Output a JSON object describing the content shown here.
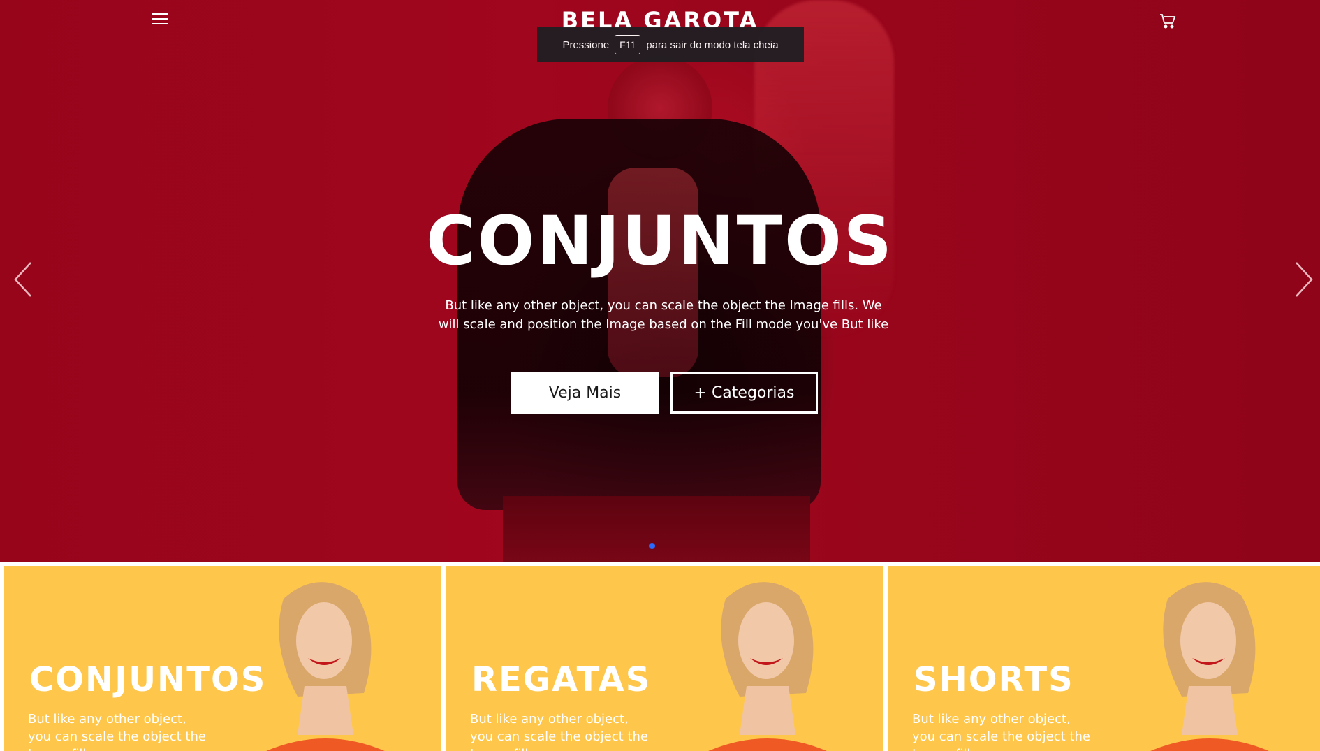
{
  "brand": "BELA GAROTA",
  "fullscreen_notice": {
    "prefix": "Pressione",
    "key": "F11",
    "suffix": "para sair do modo tela cheia"
  },
  "hero": {
    "title": "CONJUNTOS",
    "subtitle": "But like any other object, you can scale the object the Image fills. We will scale and position the Image based on the Fill mode you've But like",
    "primary_button": "Veja Mais",
    "secondary_button": "+ Categorias"
  },
  "icons": {
    "menu": "menu-icon",
    "cart": "cart-icon",
    "prev": "chevron-left-icon",
    "next": "chevron-right-icon"
  },
  "colors": {
    "hero_red": "#9a061c",
    "card_yellow": "#fec74b",
    "dot_active": "#2a6bff"
  },
  "categories": [
    {
      "title": "CONJUNTOS",
      "text": "But like any other object, you can scale the object the Image fills."
    },
    {
      "title": "REGATAS",
      "text": "But like any other object, you can scale the object the Image fills."
    },
    {
      "title": "SHORTS",
      "text": "But like any other object, you can scale the object the Image fills."
    }
  ]
}
